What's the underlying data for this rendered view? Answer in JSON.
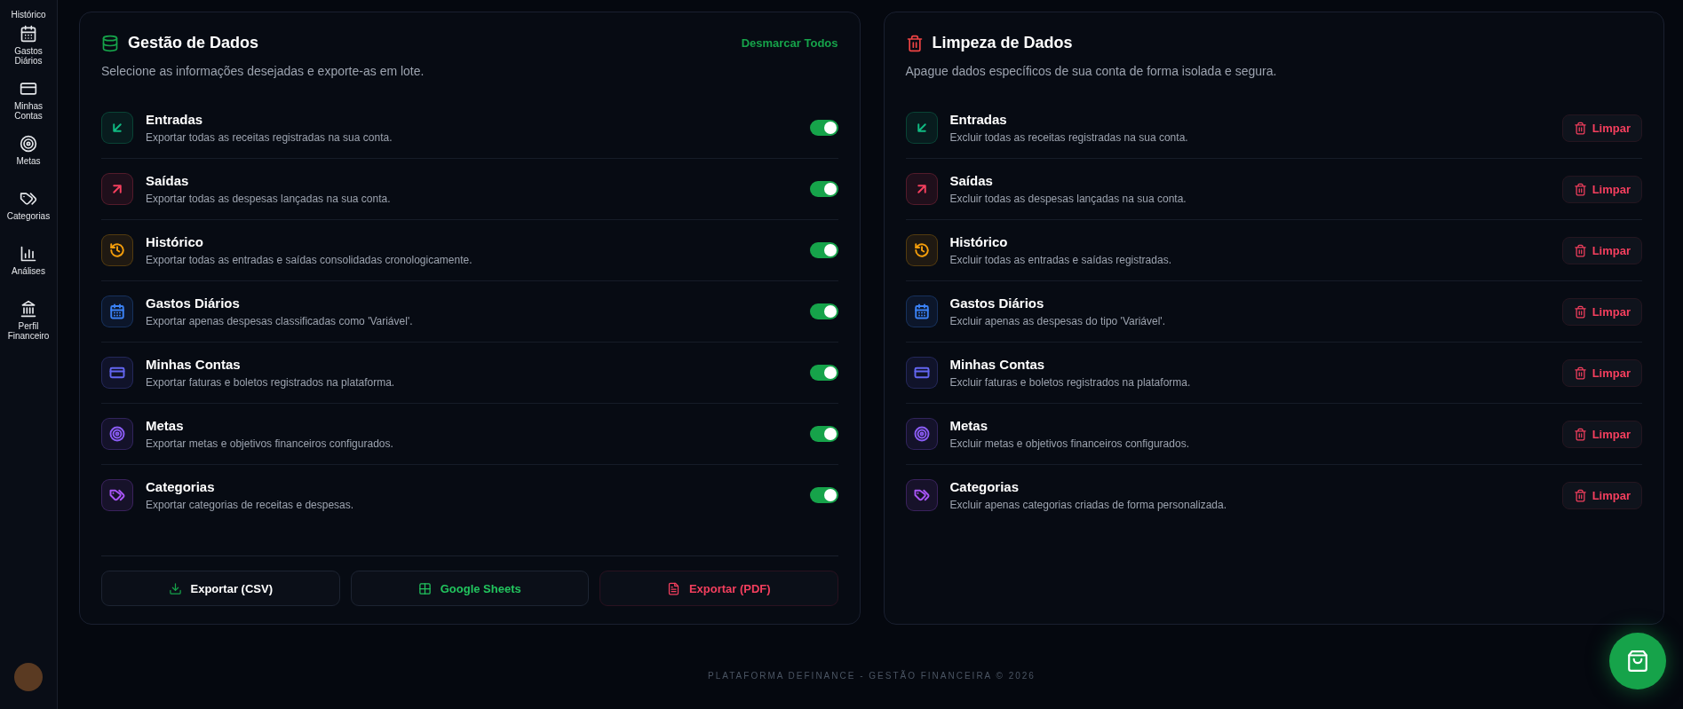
{
  "sidebar": {
    "items": [
      {
        "label": "Histórico"
      },
      {
        "label": "Gastos Diários"
      },
      {
        "label": "Minhas Contas"
      },
      {
        "label": "Metas"
      },
      {
        "label": "Categorias"
      },
      {
        "label": "Análises"
      },
      {
        "label": "Perfil Financeiro"
      }
    ]
  },
  "export_panel": {
    "title": "Gestão de Dados",
    "action": "Desmarcar Todos",
    "subtitle": "Selecione as informações desejadas e exporte-as em lote.",
    "items": [
      {
        "color": "#10b981",
        "title": "Entradas",
        "description": "Exportar todas as receitas registradas na sua conta.",
        "on": true
      },
      {
        "color": "#f43f5e",
        "title": "Saídas",
        "description": "Exportar todas as despesas lançadas na sua conta.",
        "on": true
      },
      {
        "color": "#f59e0b",
        "title": "Histórico",
        "description": "Exportar todas as entradas e saídas consolidadas cronologicamente.",
        "on": true
      },
      {
        "color": "#3b82f6",
        "title": "Gastos Diários",
        "description": "Exportar apenas despesas classificadas como 'Variável'.",
        "on": true
      },
      {
        "color": "#6366f1",
        "title": "Minhas Contas",
        "description": "Exportar faturas e boletos registrados na plataforma.",
        "on": true
      },
      {
        "color": "#8b5cf6",
        "title": "Metas",
        "description": "Exportar metas e objetivos financeiros configurados.",
        "on": true
      },
      {
        "color": "#a855f7",
        "title": "Categorias",
        "description": "Exportar categorias de receitas e despesas.",
        "on": true
      }
    ],
    "buttons": [
      {
        "kind": "csv",
        "label": "Exportar (CSV)"
      },
      {
        "kind": "sheets",
        "label": "Google Sheets"
      },
      {
        "kind": "pdf",
        "label": "Exportar (PDF)"
      }
    ]
  },
  "cleanup_panel": {
    "title": "Limpeza de Dados",
    "subtitle": "Apague dados específicos de sua conta de forma isolada e segura.",
    "items": [
      {
        "color": "#10b981",
        "title": "Entradas",
        "description": "Excluir todas as receitas registradas na sua conta.",
        "button": "Limpar"
      },
      {
        "color": "#f43f5e",
        "title": "Saídas",
        "description": "Excluir todas as despesas lançadas na sua conta.",
        "button": "Limpar"
      },
      {
        "color": "#f59e0b",
        "title": "Histórico",
        "description": "Excluir todas as entradas e saídas registradas.",
        "button": "Limpar"
      },
      {
        "color": "#3b82f6",
        "title": "Gastos Diários",
        "description": "Excluir apenas as despesas do tipo 'Variável'.",
        "button": "Limpar"
      },
      {
        "color": "#6366f1",
        "title": "Minhas Contas",
        "description": "Excluir faturas e boletos registrados na plataforma.",
        "button": "Limpar"
      },
      {
        "color": "#8b5cf6",
        "title": "Metas",
        "description": "Excluir metas e objetivos financeiros configurados.",
        "button": "Limpar"
      },
      {
        "color": "#a855f7",
        "title": "Categorias",
        "description": "Excluir apenas categorias criadas de forma personalizada.",
        "button": "Limpar"
      }
    ]
  },
  "footer": "PLATAFORMA DEFINANCE - GESTÃO FINANCEIRA © 2026"
}
